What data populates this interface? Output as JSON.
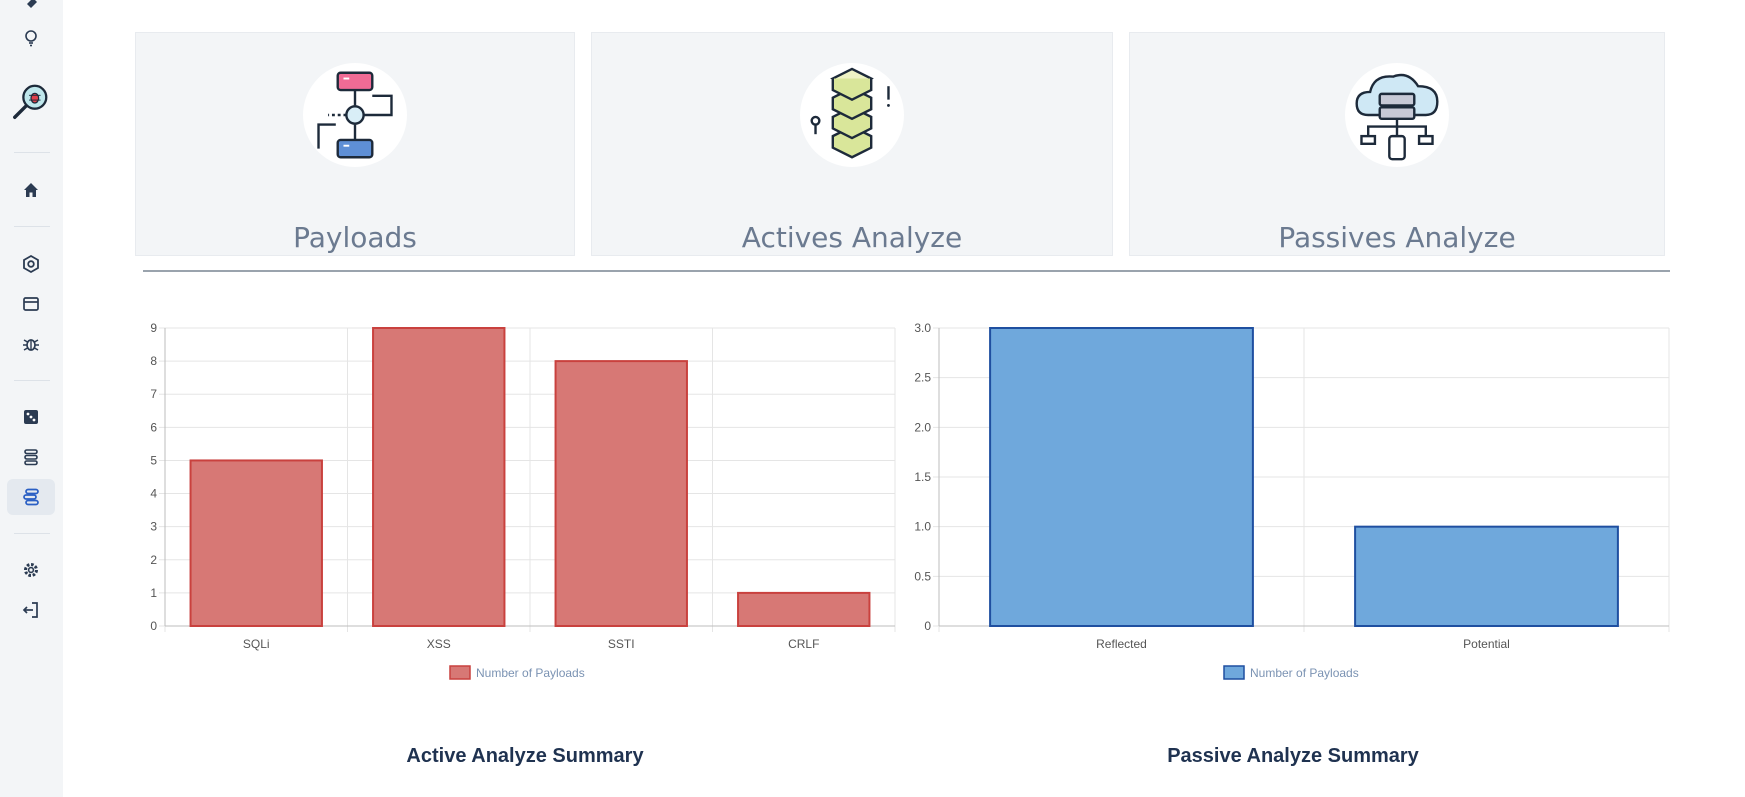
{
  "colors": {
    "active_bar": "#d77875",
    "active_border": "#c9413e",
    "passive_bar": "#6fa8dc",
    "passive_border": "#1f4fa0",
    "grid": "#e5e5e5"
  },
  "sidebar": {
    "items": [
      {
        "name": "pin-icon"
      },
      {
        "name": "lightbulb-icon"
      },
      {
        "name": "logo-bug-magnifier-icon"
      },
      {
        "name": "home-icon"
      },
      {
        "name": "target-icon"
      },
      {
        "name": "window-icon"
      },
      {
        "name": "bug-icon"
      },
      {
        "name": "dice-icon"
      },
      {
        "name": "list-icon"
      },
      {
        "name": "flow-icon",
        "active": true
      },
      {
        "name": "settings-icon"
      },
      {
        "name": "logout-icon"
      }
    ]
  },
  "cards": [
    {
      "title": "Payloads",
      "icon": "network-servers-icon"
    },
    {
      "title": "Actives Analyze",
      "icon": "stacked-boxes-icon"
    },
    {
      "title": "Passives Analyze",
      "icon": "cloud-server-icon"
    }
  ],
  "chart_data": [
    {
      "type": "bar",
      "categories": [
        "SQLi",
        "XSS",
        "SSTI",
        "CRLF"
      ],
      "series": [
        {
          "name": "Number of Payloads",
          "values": [
            5,
            9,
            8,
            1
          ]
        }
      ],
      "ylim": [
        0,
        9
      ],
      "yticks": [
        "0",
        "1",
        "2",
        "3",
        "4",
        "5",
        "6",
        "7",
        "8",
        "9"
      ],
      "grid": true,
      "legend": "bottom",
      "caption": "Active Analyze Summary"
    },
    {
      "type": "bar",
      "categories": [
        "Reflected",
        "Potential"
      ],
      "series": [
        {
          "name": "Number of Payloads",
          "values": [
            3,
            1
          ]
        }
      ],
      "ylim": [
        0,
        3
      ],
      "yticks": [
        "0",
        "0.5",
        "1.0",
        "1.5",
        "2.0",
        "2.5",
        "3.0"
      ],
      "grid": true,
      "legend": "bottom",
      "caption": "Passive Analyze Summary"
    }
  ]
}
